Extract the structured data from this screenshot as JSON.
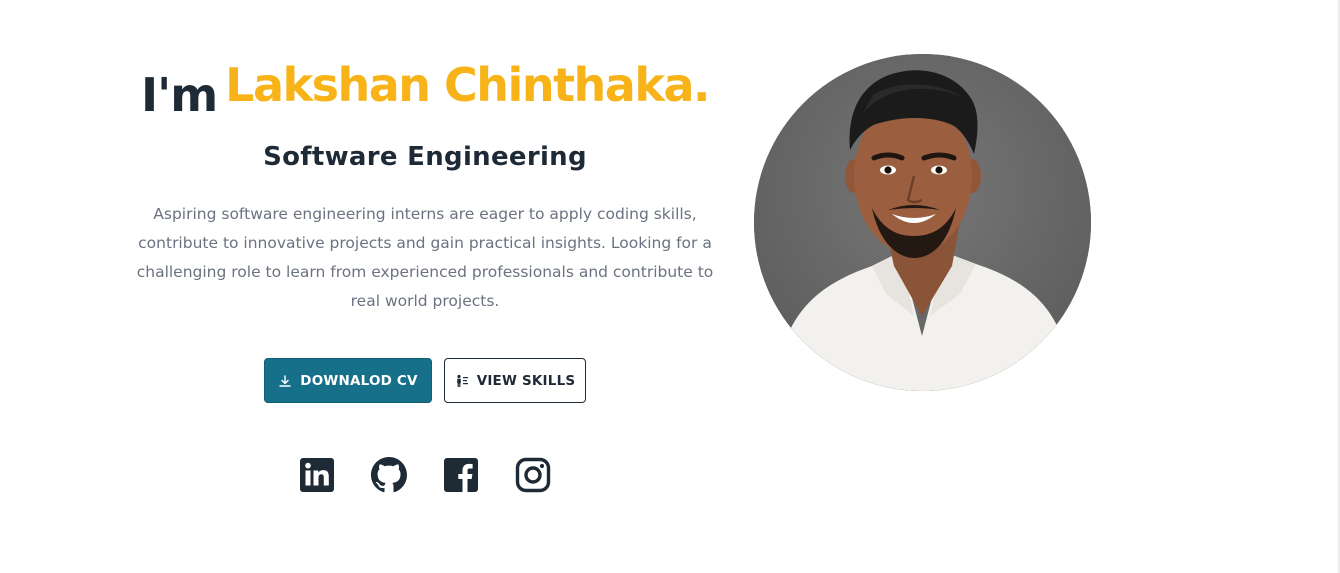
{
  "hero": {
    "greeting": "I'm",
    "name": "Lakshan Chinthaka.",
    "role": "Software Engineering",
    "bio": "Aspiring software engineering interns are eager to apply coding skills, contribute to innovative projects and gain practical insights. Looking for a challenging role to learn from experienced professionals and contribute to real world projects."
  },
  "actions": {
    "download_label": "DOWNALOD CV",
    "download_icon": "download-icon",
    "skills_label": "VIEW SKILLS",
    "skills_icon": "skills-icon"
  },
  "socials": [
    {
      "icon": "linkedin-icon"
    },
    {
      "icon": "github-icon"
    },
    {
      "icon": "facebook-icon"
    },
    {
      "icon": "instagram-icon"
    }
  ],
  "colors": {
    "accent": "#f7b318",
    "dark": "#1f2a37",
    "primary_button": "#16708a",
    "body_text": "#6b7280"
  }
}
